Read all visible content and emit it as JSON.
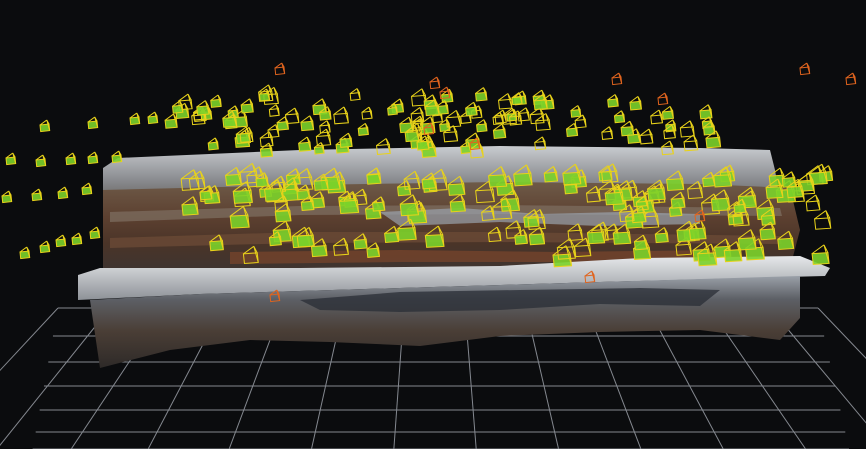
{
  "viewer": {
    "background": "#0b0c0e",
    "grid_color": "#9a9ea6",
    "model": "textured-mesh",
    "camera_icon_aligned": "camera-frustum-icon",
    "camera_color_aligned": "#7bd12a",
    "camera_color_frustum": "#e8d21a",
    "camera_color_unaligned": "#e0641e",
    "grid_visible": true
  }
}
